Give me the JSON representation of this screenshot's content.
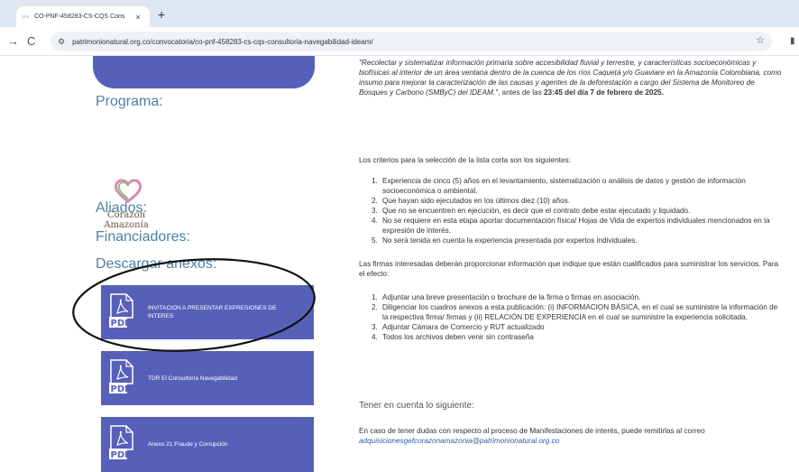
{
  "browser": {
    "tab_title": "CO-PNF-458283-CS-CQS Cons",
    "tab_close": "×",
    "new_tab": "+",
    "back": "→",
    "reload": "C",
    "url": "patrimonionatural.org.co/convocatoria/co-pnf-458283-cs-cqs-consultoria-navegabilidad-ideam/",
    "icons": [
      "tab-favicon-icon",
      "tune-icon",
      "star-icon",
      "extension-icon"
    ]
  },
  "sidebar": {
    "programa": "Programa:",
    "logo_line1": "Corazón",
    "logo_line2": "Amazonía",
    "aliados": "Aliados:",
    "financiadores": "Financiadores:",
    "descargar": "Descargar anexos:",
    "anexos": [
      {
        "label": "INVITACION A PRESENTAR EXPRESIONES DE INTERES",
        "icon": "pdf-icon"
      },
      {
        "label": "TDR El Consultoría Navegabilidad",
        "icon": "pdf-icon"
      },
      {
        "label": "Anexo 21 Fraude y Corrupción",
        "icon": "pdf-icon"
      }
    ],
    "pdf_text": "PDF",
    "colors": {
      "accent": "#5760b8",
      "heading": "#4e7fa6"
    }
  },
  "main": {
    "quote": "\"Recolectar y sistematizar información primaria sobre accesibilidad fluvial y terrestre, y características socioeconómicas y biofísicas al interior de un área ventana dentro de la cuenca de los ríos Caquetá y/o Guaviare en la Amazonía Colombiana, como insumo para mejorar la caracterización de las causas y agentes de la deforestación a cargo del Sistema de Monitoreo de Bosques y Carbono (SMByC) del IDEAM.\"",
    "quote_tail": ", antes de las",
    "deadline": "23:45 del día 7 de febrero de 2025.",
    "criterios_intro": "Los criterios para la selección de la lista corta son los siguientes:",
    "criterios": [
      "Experiencia de cinco (5) años en el levantamiento, sistematización o análisis de datos y gestión de información socioeconómica o ambiental.",
      "Que hayan sido ejecutados en los últimos diez (10) años.",
      "Que no se encuentren en ejecución, es decir que el contrato debe estar ejecutado y liquidado.",
      "No se requiere en esta etapa aportar documentación física/ Hojas de Vida de expertos individuales mencionados en la expresión de interés.",
      "No será tenida en cuenta la experiencia presentada por expertos individuales."
    ],
    "firmas_intro": "Las firmas interesadas deberán proporcionar información que indique que están cualificados para suministrar los servicios. Para el efecto:",
    "requisitos": [
      "Adjuntar una breve presentación o brochure de la firma o firmas en asociación.",
      "Diligenciar los cuadros anexos a esta publicación: (i) INFORMACION BÁSICA, en el cual se suministre la información de la respectiva firma/ firmas y (ii) RELACIÓN DE EXPERIENCIA en el cual se suministre la experiencia solicitada.",
      "Adjuntar Cámara de Comercio y RUT actualizado",
      "Todos los archivos deben venir sin contraseña"
    ],
    "tener_en_cuenta": "Tener en cuenta lo siguiente:",
    "dudas": "En caso de tener dudas con respecto al proceso de Manifestaciones de interés, puede remitirlas al correo",
    "email": "adquisicionesgefcorazonamazonia@patrimonionatural.org.co"
  }
}
